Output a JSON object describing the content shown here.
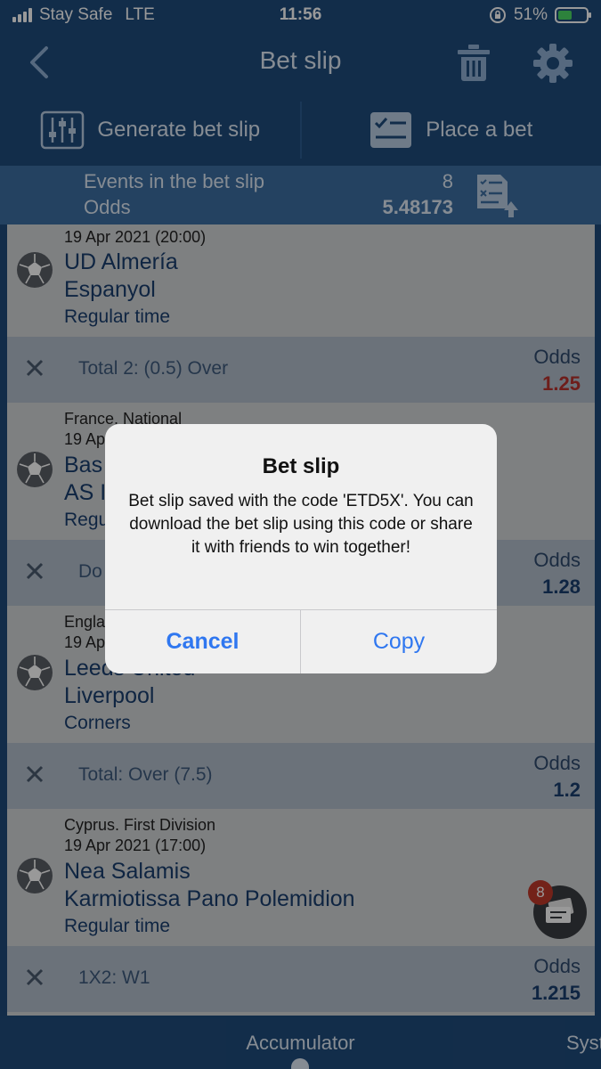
{
  "status": {
    "carrier": "Stay Safe",
    "network": "LTE",
    "time": "11:56",
    "battery": "51%",
    "battery_level": 0.51
  },
  "nav": {
    "title": "Bet slip"
  },
  "actions": {
    "generate_label": "Generate bet slip",
    "place_label": "Place a bet"
  },
  "summary": {
    "events_label": "Events in the bet slip",
    "events_count": "8",
    "odds_label": "Odds",
    "odds_value": "5.48173"
  },
  "events": [
    {
      "league": "",
      "date": "19 Apr 2021 (20:00)",
      "team1": "UD Almería",
      "team2": "Espanyol",
      "market": "Regular time",
      "pick": "Total 2: (0.5) Over",
      "odds_label": "Odds",
      "odds": "1.25"
    },
    {
      "league": "France. National",
      "date": "19 Ap",
      "team1": "Bas",
      "team2": "AS I",
      "market": "Regu",
      "pick": "Do",
      "odds_label": "Odds",
      "odds": "1.28"
    },
    {
      "league": "Engla",
      "date": "19 Ap",
      "team1": "Leeds United",
      "team2": "Liverpool",
      "market": "Corners",
      "pick": "Total: Over (7.5)",
      "odds_label": "Odds",
      "odds": "1.2"
    },
    {
      "league": "Cyprus. First Division",
      "date": "19 Apr 2021 (17:00)",
      "team1": "Nea Salamis",
      "team2": "Karmiotissa Pano Polemidion",
      "market": "Regular time",
      "pick": "1X2: W1",
      "odds_label": "Odds",
      "odds": "1.215"
    }
  ],
  "fab": {
    "badge": "8"
  },
  "bottom": {
    "tab_accumulator": "Accumulator",
    "tab_system": "Syst"
  },
  "dialog": {
    "title": "Bet slip",
    "message": "Bet slip saved with the code 'ETD5X'. You can download the bet slip using this code or share it with friends to win together!",
    "cancel": "Cancel",
    "copy": "Copy"
  },
  "colors": {
    "header": "#1f4b7c",
    "summary": "#3c6fa2",
    "row_bg": "#d3d5d8",
    "bet_bg": "#b3bfcc",
    "odds_red": "#b8322e",
    "link_blue": "#2f77f0"
  }
}
